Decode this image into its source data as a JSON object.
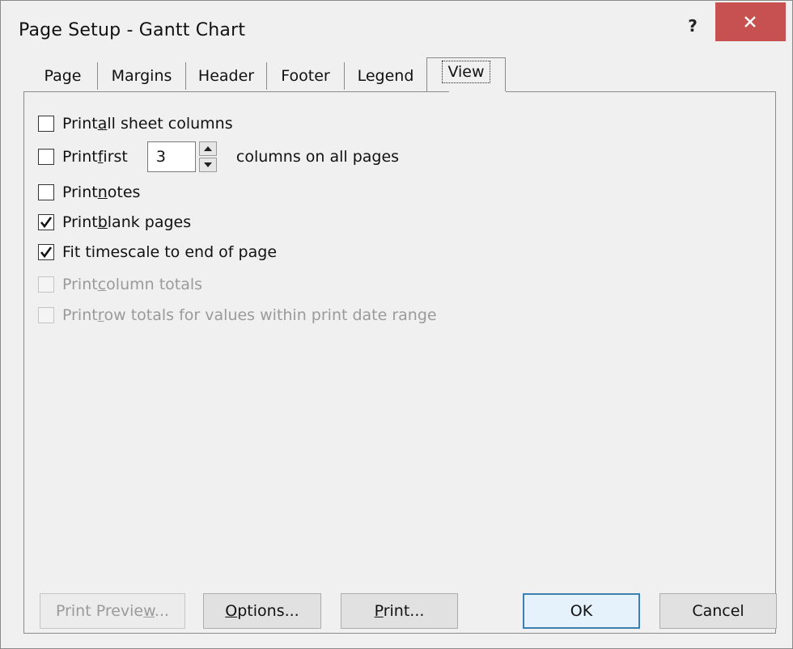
{
  "window": {
    "title": "Page Setup - Gantt Chart",
    "help_label": "?",
    "close_icon": "close-icon",
    "close_color": "#c75050"
  },
  "tabs": [
    {
      "label": "Page",
      "active": false
    },
    {
      "label": "Margins",
      "active": false
    },
    {
      "label": "Header",
      "active": false
    },
    {
      "label": "Footer",
      "active": false
    },
    {
      "label": "Legend",
      "active": false
    },
    {
      "label": "View",
      "active": true
    }
  ],
  "options": {
    "print_all_sheet_columns": {
      "pre": "Print ",
      "u": "a",
      "post": "ll sheet columns",
      "checked": false,
      "enabled": true
    },
    "print_first": {
      "pre": "Print ",
      "u": "f",
      "post": "irst",
      "checked": false,
      "enabled": true,
      "value": "3",
      "suffix": "columns on all pages"
    },
    "print_notes": {
      "pre": "Print ",
      "u": "n",
      "post": "otes",
      "checked": false,
      "enabled": true
    },
    "print_blank_pages": {
      "pre": "Print ",
      "u": "b",
      "post": "lank pages",
      "checked": true,
      "enabled": true
    },
    "fit_timescale": {
      "pre": "Fit timescale to end of pa",
      "u": "g",
      "post": "e",
      "checked": true,
      "enabled": true
    },
    "print_column_totals": {
      "pre": "Print ",
      "u": "c",
      "post": "olumn totals",
      "checked": false,
      "enabled": false
    },
    "print_row_totals": {
      "pre": "Print ",
      "u": "r",
      "post": "ow totals for values within print date range",
      "checked": false,
      "enabled": false
    }
  },
  "buttons": {
    "print_preview": {
      "pre": "Print Previe",
      "u": "w",
      "post": "...",
      "enabled": false
    },
    "options": {
      "pre": "",
      "u": "O",
      "post": "ptions...",
      "enabled": true
    },
    "print": {
      "pre": "",
      "u": "P",
      "post": "rint...",
      "enabled": true
    },
    "ok": {
      "label": "OK",
      "default": true
    },
    "cancel": {
      "label": "Cancel"
    }
  }
}
